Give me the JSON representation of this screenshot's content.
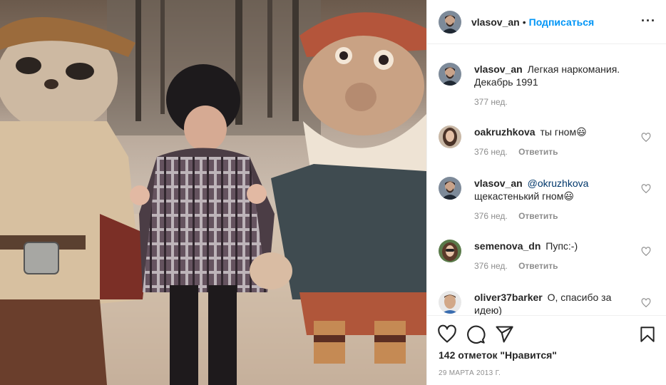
{
  "photo": {
    "alt_icon": "photo-image"
  },
  "header": {
    "username": "vlasov_an",
    "separator": "•",
    "follow_label": "Подписаться",
    "more_label": "···"
  },
  "comments": [
    {
      "username": "vlasov_an",
      "text": "Легкая наркомания. Декабрь 1991",
      "time": "377 нед.",
      "reply": ""
    },
    {
      "username": "oakruzhkova",
      "text": "ты гном😃",
      "time": "376 нед.",
      "reply": "Ответить"
    },
    {
      "username": "vlasov_an",
      "mention": "@okruzhkova",
      "text": "щекастенький гном😃",
      "time": "376 нед.",
      "reply": "Ответить"
    },
    {
      "username": "semenova_dn",
      "text": "Пупс:-)",
      "time": "376 нед.",
      "reply": "Ответить"
    },
    {
      "username": "oliver37barker",
      "text": "О, спасибо за идею)",
      "time": "",
      "reply": ""
    }
  ],
  "actions": {
    "likes": "142 отметок \"Нравится\"",
    "date": "29 МАРТА 2013 Г."
  },
  "colors": {
    "accent": "#0095f6",
    "text": "#262626",
    "muted": "#8e8e8e",
    "border": "#efefef"
  }
}
